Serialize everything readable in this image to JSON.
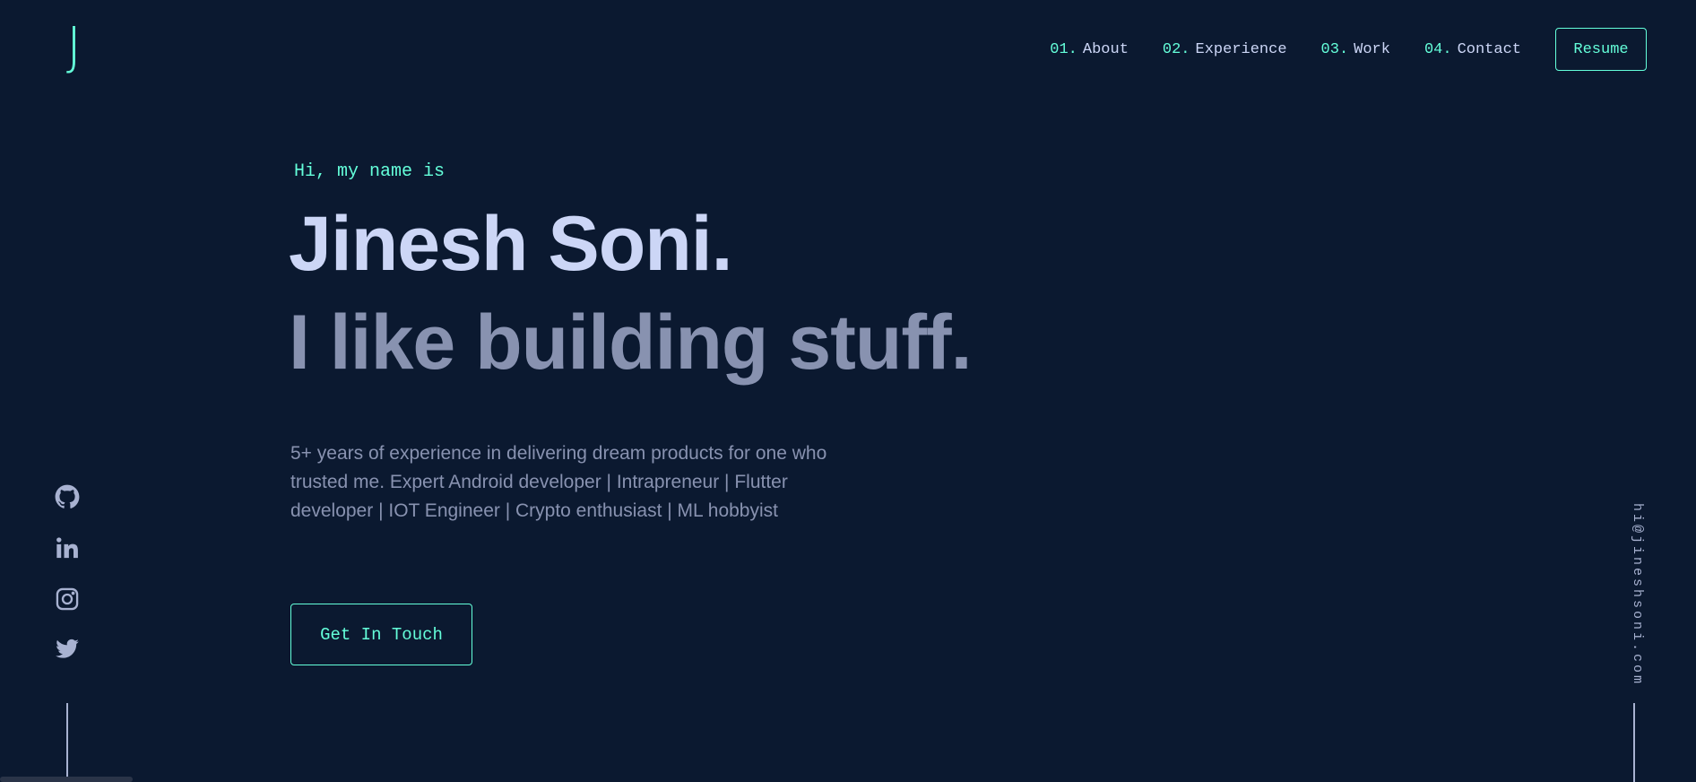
{
  "logo": "J",
  "nav": {
    "items": [
      {
        "num": "01.",
        "label": "About"
      },
      {
        "num": "02.",
        "label": "Experience"
      },
      {
        "num": "03.",
        "label": "Work"
      },
      {
        "num": "04.",
        "label": "Contact"
      }
    ],
    "resume_label": "Resume"
  },
  "hero": {
    "intro": "Hi, my name is",
    "name": "Jinesh Soni.",
    "tagline": "I like building stuff.",
    "bio": "5+ years of experience in delivering dream products for one who trusted me. Expert Android developer | Intrapreneur | Flutter developer | IOT Engineer | Crypto enthusiast | ML hobbyist",
    "cta_label": "Get In Touch"
  },
  "social": {
    "icons": [
      "github-icon",
      "linkedin-icon",
      "instagram-icon",
      "twitter-icon"
    ]
  },
  "email": "hi@jineshsoni.com",
  "colors": {
    "background": "#0b1930",
    "accent": "#64ffda",
    "heading": "#ccd6f6",
    "muted": "#8892b0"
  }
}
